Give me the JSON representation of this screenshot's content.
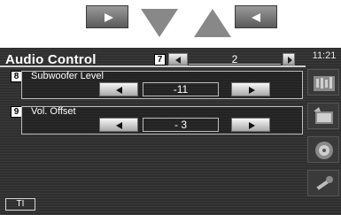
{
  "top_controls": {
    "buttons": [
      {
        "icon": "play-right-arrow-icon"
      },
      {
        "icon": "triangle-down-icon"
      },
      {
        "icon": "triangle-up-icon"
      },
      {
        "icon": "play-left-arrow-icon"
      }
    ]
  },
  "screen": {
    "title": "Audio Control",
    "clock": "11:21",
    "page": {
      "callout": "7",
      "number": "2"
    },
    "settings": [
      {
        "callout": "8",
        "label": "Subwoofer Level",
        "value": "-11"
      },
      {
        "callout": "9",
        "label": "Vol. Offset",
        "value": "- 3"
      }
    ],
    "sidebar_icons": [
      "equalizer-icon",
      "film-icon",
      "speaker-icon",
      "tools-icon"
    ],
    "bottom_button": "TI"
  },
  "colors": {
    "screen_bg": "#2f2f2f",
    "text": "#ffffff",
    "button_light": "#f8f8f8",
    "button_dark": "#a9a9a9"
  }
}
